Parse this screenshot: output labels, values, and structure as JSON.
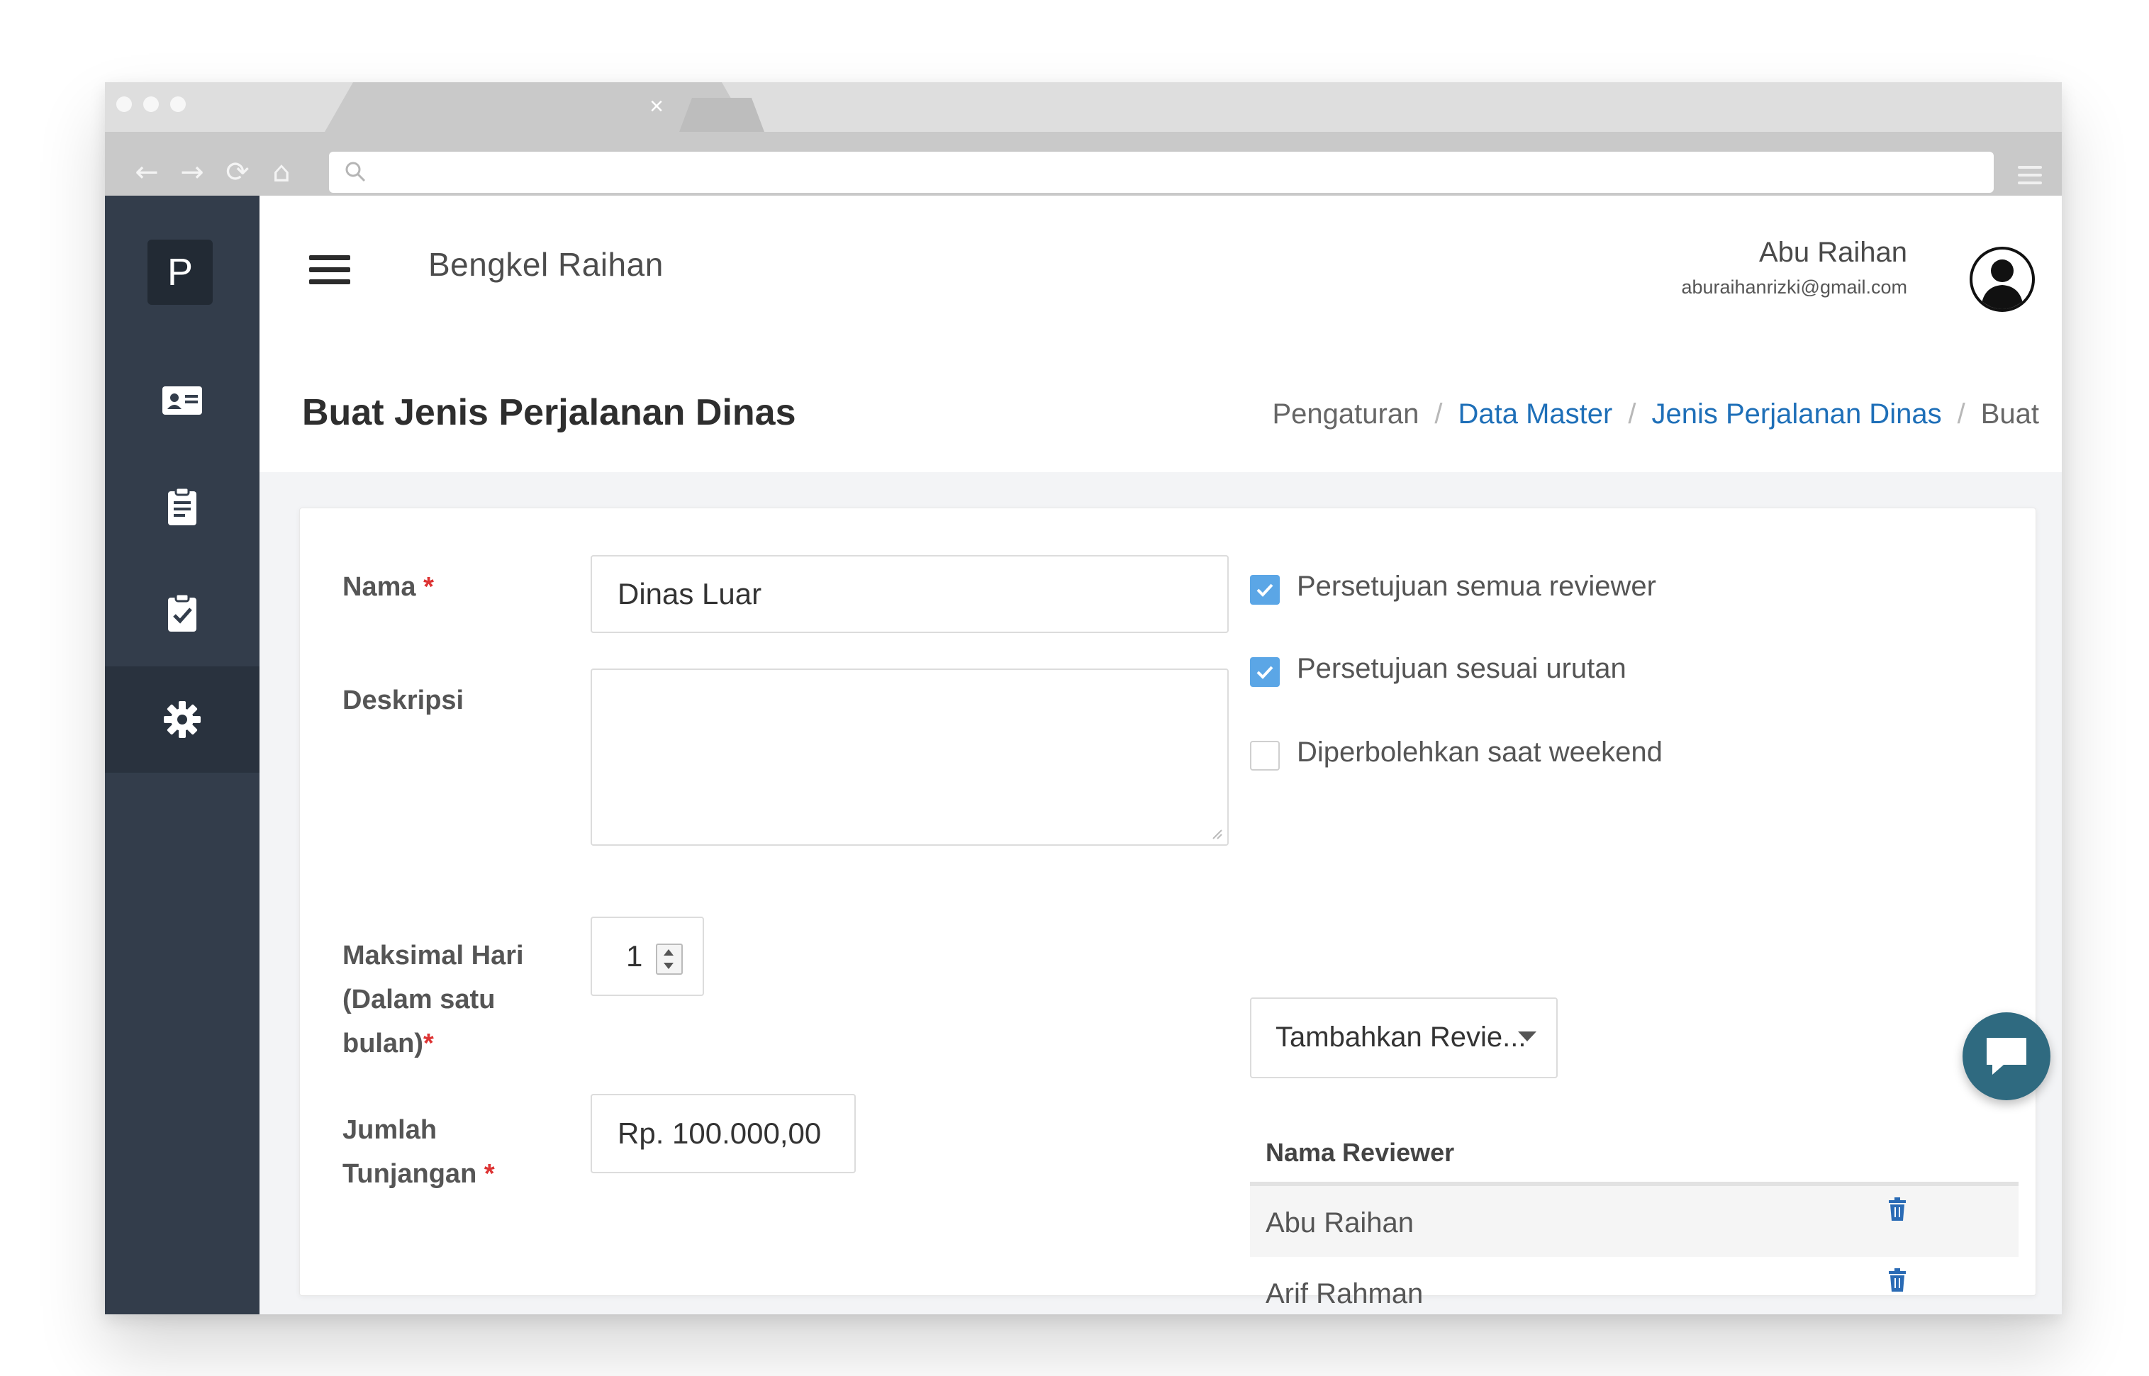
{
  "browser": {
    "tab_close_glyph": "×",
    "nav_icons": [
      "back-arrow-icon",
      "forward-arrow-icon",
      "reload-icon",
      "home-icon"
    ],
    "address_icon": "search-icon"
  },
  "sidebar": {
    "logo": "P",
    "items": [
      {
        "icon": "id-card-icon",
        "active": false
      },
      {
        "icon": "clipboard-list-icon",
        "active": false
      },
      {
        "icon": "clipboard-check-icon",
        "active": false
      },
      {
        "icon": "gear-icon",
        "active": true
      }
    ],
    "colors": {
      "background": "#333d4b",
      "active": "#29323e"
    }
  },
  "header": {
    "brand": "Bengkel Raihan",
    "user_name": "Abu Raihan",
    "user_email": "aburaihanrizki@gmail.com"
  },
  "page": {
    "title": "Buat Jenis Perjalanan Dinas",
    "breadcrumb": {
      "b1": "Pengaturan",
      "b2": "Data Master",
      "b3": "Jenis Perjalanan Dinas",
      "b4": "Buat",
      "separator": "/"
    }
  },
  "form": {
    "nama": {
      "label": "Nama",
      "value": "Dinas Luar"
    },
    "deskripsi": {
      "label": "Deskripsi",
      "value": ""
    },
    "maks_hari": {
      "label_1": "Maksimal Hari",
      "label_2": "(Dalam satu",
      "label_3": "bulan)",
      "value": "1"
    },
    "tunjangan": {
      "label_1": "Jumlah",
      "label_2": "Tunjangan",
      "value": "Rp. 100.000,00"
    },
    "required_mark": "*"
  },
  "options": {
    "semua_reviewer": {
      "label": "Persetujuan semua reviewer",
      "checked": true
    },
    "sesuai_urutan": {
      "label": "Persetujuan sesuai urutan",
      "checked": true
    },
    "weekend": {
      "label": "Diperbolehkan saat weekend",
      "checked": false
    },
    "reviewer_select": "Tambahkan Revie..."
  },
  "reviewers": {
    "column": "Nama Reviewer",
    "rows": [
      {
        "name": "Abu Raihan"
      },
      {
        "name": "Arif Rahman"
      }
    ]
  },
  "colors": {
    "accent": "#1e6fb8",
    "checkbox": "#5ba6e6",
    "required": "#d33333",
    "chat_button": "#2f6a80"
  }
}
